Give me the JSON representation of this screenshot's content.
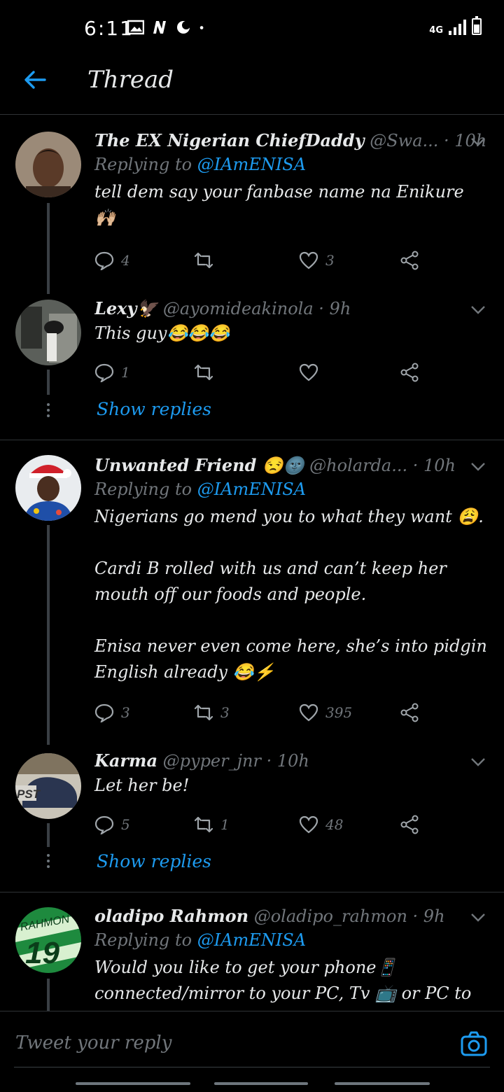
{
  "status_bar": {
    "time": "6:11",
    "network": "4G",
    "notification_icons": [
      "gallery-icon",
      "n-icon",
      "moon-app-icon",
      "dot-icon"
    ]
  },
  "header": {
    "title": "Thread"
  },
  "tweets": [
    {
      "name": "The EX Nigerian ChiefDaddy",
      "handle": "@Swa...",
      "time": "· 10h",
      "replying_prefix": "Replying to",
      "replying_to": "@IAmENISA",
      "text": "tell dem say your fanbase name na Enikure\n🙌🏼",
      "replies": "4",
      "retweets": "",
      "likes": "3"
    },
    {
      "name": "Lexy🦅",
      "handle": "@ayomideakinola",
      "time": "· 9h",
      "text": "This guy😂😂😂",
      "replies": "1",
      "retweets": "",
      "likes": "",
      "show_replies": "Show replies"
    },
    {
      "name": "Unwanted Friend 😒🌚",
      "handle": "@holarda...",
      "time": "· 10h",
      "replying_prefix": "Replying to",
      "replying_to": "@IAmENISA",
      "text": "Nigerians go mend you to what they want 😩.\n\nCardi B rolled with us and can’t keep her\nmouth off our foods and people.\n\nEnisa never even come here, she’s into pidgin\nEnglish already 😂⚡",
      "replies": "3",
      "retweets": "3",
      "likes": "395"
    },
    {
      "name": "Karma",
      "handle": "@pyper_jnr",
      "time": "· 10h",
      "text": "Let her be!",
      "replies": "5",
      "retweets": "1",
      "likes": "48",
      "show_replies": "Show replies"
    },
    {
      "name": "oladipo Rahmon",
      "handle": "@oladipo_rahmon",
      "time": "· 9h",
      "replying_prefix": "Replying to",
      "replying_to": "@IAmENISA",
      "text": "Would you like to get your phone📱\nconnected/mirror to your PC, Tv 📺 or PC to"
    }
  ],
  "composer": {
    "placeholder": "Tweet your reply"
  },
  "colors": {
    "accent": "#1d9bf0",
    "muted": "#71767b",
    "background": "#000000"
  }
}
